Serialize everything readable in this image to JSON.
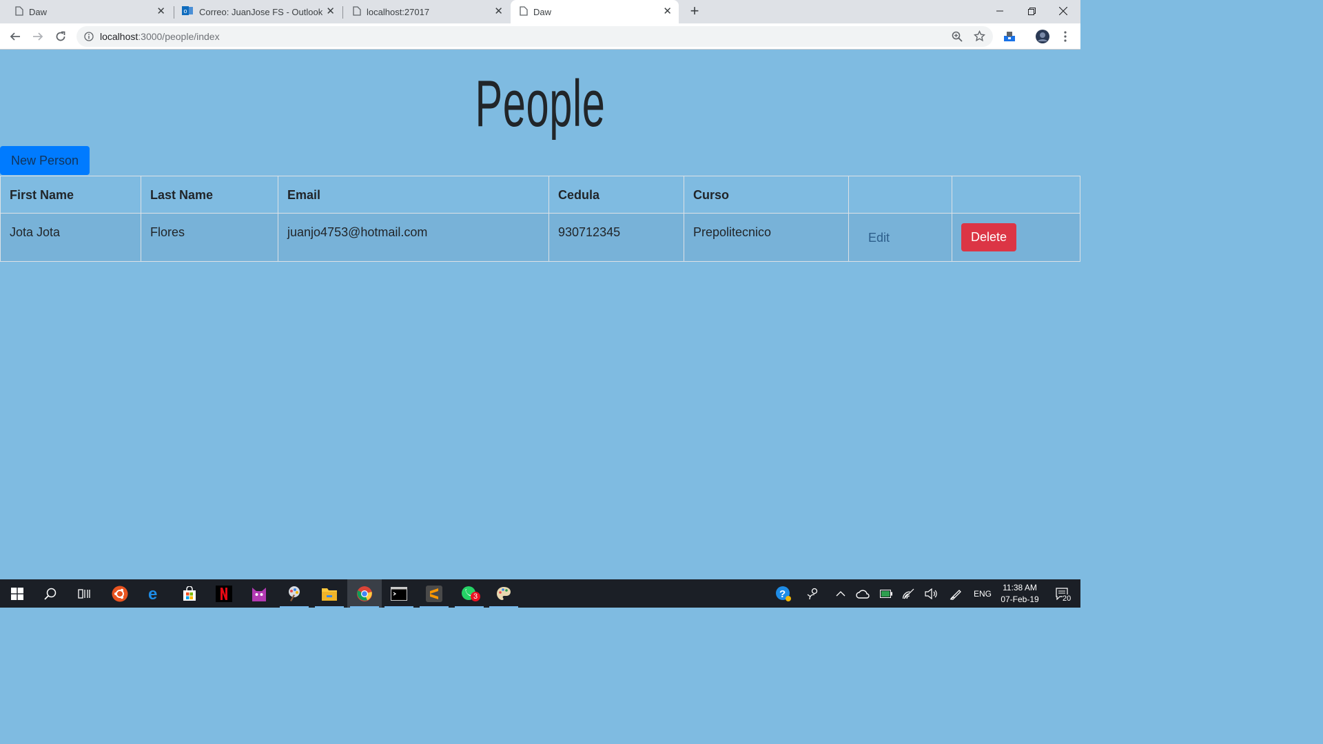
{
  "browser": {
    "tabs": [
      {
        "title": "Daw",
        "active": false,
        "icon": "page-icon"
      },
      {
        "title": "Correo: JuanJose FS - Outlook",
        "active": false,
        "icon": "outlook-icon"
      },
      {
        "title": "localhost:27017",
        "active": false,
        "icon": "page-icon"
      },
      {
        "title": "Daw",
        "active": true,
        "icon": "page-icon"
      }
    ],
    "new_tab_label": "+",
    "url_host": "localhost",
    "url_path": ":3000/people/index"
  },
  "page": {
    "title": "People",
    "new_person_label": "New Person",
    "table": {
      "headers": [
        "First Name",
        "Last Name",
        "Email",
        "Cedula",
        "Curso",
        "",
        ""
      ],
      "rows": [
        {
          "first_name": "Jota Jota",
          "last_name": "Flores",
          "email": "juanjo4753@hotmail.com",
          "cedula": "930712345",
          "curso": "Prepolitecnico",
          "edit_label": "Edit",
          "delete_label": "Delete"
        }
      ]
    }
  },
  "taskbar": {
    "apps": [
      "windows-start",
      "search",
      "task-view",
      "ubuntu",
      "edge",
      "store",
      "netflix",
      "cat-app",
      "paint-app",
      "file-explorer",
      "chrome",
      "terminal",
      "sublime-text",
      "whatsapp",
      "paint"
    ],
    "whatsapp_badge": "3",
    "language": "ENG",
    "time": "11:38 AM",
    "date": "07-Feb-19",
    "notifications": "20"
  },
  "colors": {
    "page_bg": "#7fbbe1",
    "primary": "#007bff",
    "danger": "#dc3545"
  }
}
